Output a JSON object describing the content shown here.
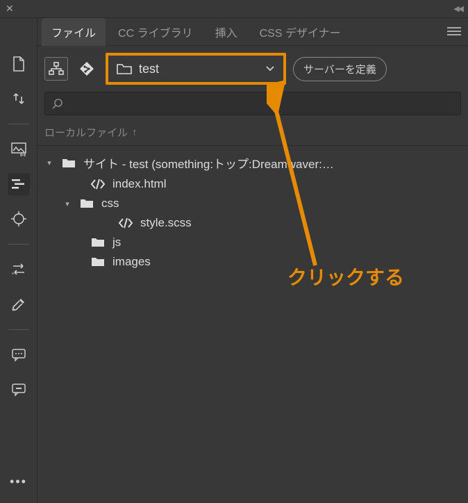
{
  "tabs": [
    {
      "label": "ファイル",
      "active": true
    },
    {
      "label": "CC ライブラリ",
      "active": false
    },
    {
      "label": "挿入",
      "active": false
    },
    {
      "label": "CSS デザイナー",
      "active": false
    }
  ],
  "siteSelect": {
    "label": "test"
  },
  "defineServer": "サーバーを定義",
  "columnHeader": "ローカルファイル",
  "tree": {
    "root": {
      "label": "サイト - test (something:トップ:Dreamwaver:…"
    },
    "index": {
      "label": "index.html"
    },
    "css": {
      "label": "css"
    },
    "stylescss": {
      "label": "style.scss"
    },
    "js": {
      "label": "js"
    },
    "images": {
      "label": "images"
    }
  },
  "annotation": {
    "text": "クリックする"
  }
}
